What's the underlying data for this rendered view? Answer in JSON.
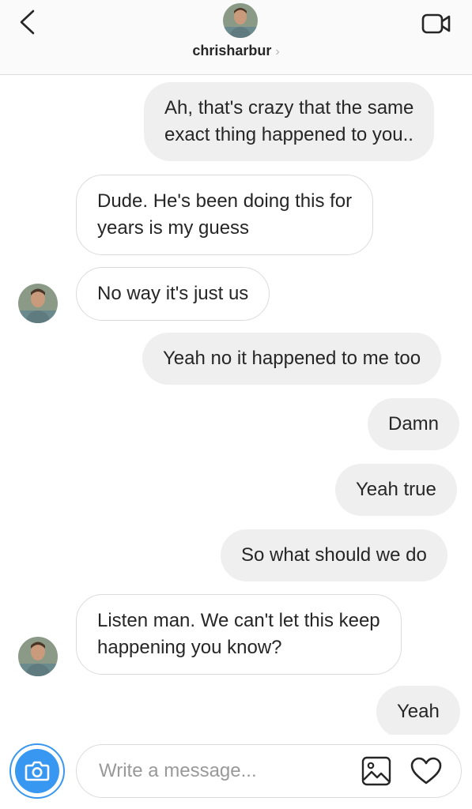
{
  "header": {
    "username": "chrisharbur",
    "chevron": "›",
    "back_icon": "chevron-left-icon",
    "video_icon": "video-camera-icon"
  },
  "messages": [
    {
      "side": "out",
      "lines": [
        "Ah, that's crazy that the same",
        "exact thing happened to you.."
      ]
    },
    {
      "side": "in",
      "lines": [
        "Dude. He's been doing this for",
        "years is my guess"
      ]
    },
    {
      "side": "in",
      "lines": [
        "No way it's just us"
      ],
      "avatar": true
    },
    {
      "side": "out",
      "lines": [
        "Yeah no it happened to me too"
      ]
    },
    {
      "side": "out",
      "lines": [
        "Damn"
      ]
    },
    {
      "side": "out",
      "lines": [
        "Yeah true"
      ]
    },
    {
      "side": "out",
      "lines": [
        "So what should we do"
      ]
    },
    {
      "side": "in",
      "lines": [
        "Listen man. We can't let this keep",
        "happening you know?"
      ],
      "avatar": true
    },
    {
      "side": "out",
      "lines": [
        "Yeah"
      ]
    }
  ],
  "composer": {
    "placeholder": "Write a message...",
    "value": "",
    "camera_icon": "camera-icon",
    "photo_icon": "photo-icon",
    "heart_icon": "heart-icon"
  },
  "colors": {
    "accent": "#3897f0",
    "outgoing_bubble": "#efefef",
    "border": "#dbdbdb",
    "text": "#262626"
  }
}
